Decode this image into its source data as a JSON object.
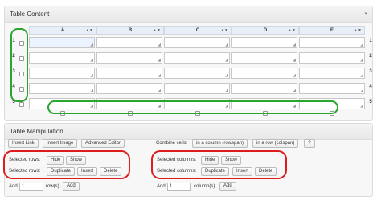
{
  "table_content": {
    "title": "Table Content",
    "columns": [
      "A",
      "B",
      "C",
      "D",
      "E"
    ],
    "rows": [
      "1",
      "2",
      "3",
      "4",
      "5"
    ]
  },
  "table_manipulation": {
    "title": "Table Manipulation",
    "insert_link": "Insert Link",
    "insert_image": "Insert Image",
    "advanced_editor": "Advanced Editor",
    "combine_cells_label": "Combine cells:",
    "rowspan_button": "in a column (rowspan)",
    "colspan_button": "in a row (colspan)",
    "help_button": "?",
    "rows_label_1": "Selected rows:",
    "rows_label_2": "Selected rows:",
    "cols_label_1": "Selected columns:",
    "cols_label_2": "Selected columns:",
    "hide": "Hide",
    "show": "Show",
    "duplicate": "Duplicate",
    "insert": "Insert",
    "delete": "Delete",
    "add_label": "Add",
    "add_rows_value": "1",
    "add_cols_value": "1",
    "rows_suffix": "row(s)",
    "cols_suffix": "column(s)",
    "add_button": "Add"
  },
  "colors": {
    "highlight_green": "#2aa52e",
    "highlight_red": "#dd1c1c"
  }
}
